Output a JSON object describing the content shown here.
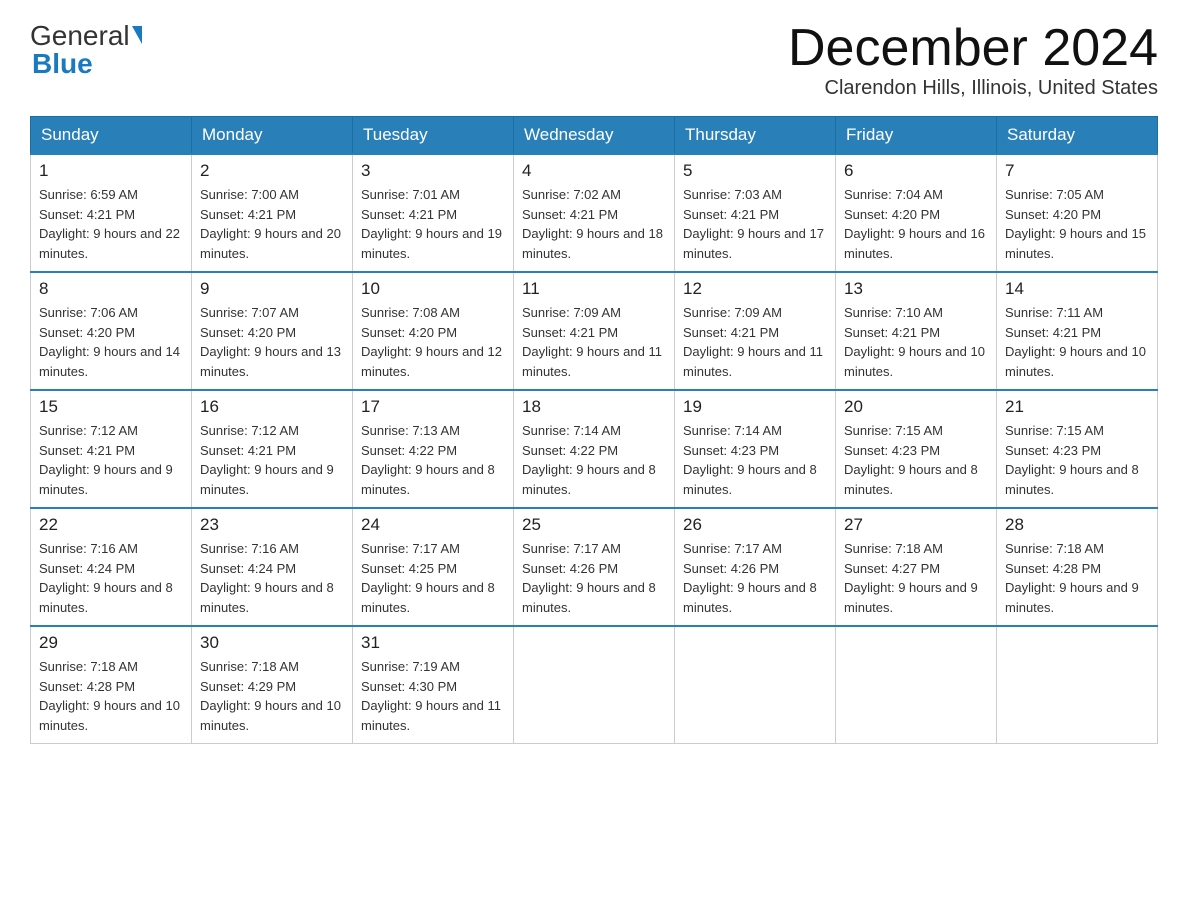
{
  "logo": {
    "general": "General",
    "blue": "Blue"
  },
  "header": {
    "month": "December 2024",
    "location": "Clarendon Hills, Illinois, United States"
  },
  "days_of_week": [
    "Sunday",
    "Monday",
    "Tuesday",
    "Wednesday",
    "Thursday",
    "Friday",
    "Saturday"
  ],
  "weeks": [
    [
      {
        "day": "1",
        "sunrise": "6:59 AM",
        "sunset": "4:21 PM",
        "daylight": "9 hours and 22 minutes."
      },
      {
        "day": "2",
        "sunrise": "7:00 AM",
        "sunset": "4:21 PM",
        "daylight": "9 hours and 20 minutes."
      },
      {
        "day": "3",
        "sunrise": "7:01 AM",
        "sunset": "4:21 PM",
        "daylight": "9 hours and 19 minutes."
      },
      {
        "day": "4",
        "sunrise": "7:02 AM",
        "sunset": "4:21 PM",
        "daylight": "9 hours and 18 minutes."
      },
      {
        "day": "5",
        "sunrise": "7:03 AM",
        "sunset": "4:21 PM",
        "daylight": "9 hours and 17 minutes."
      },
      {
        "day": "6",
        "sunrise": "7:04 AM",
        "sunset": "4:20 PM",
        "daylight": "9 hours and 16 minutes."
      },
      {
        "day": "7",
        "sunrise": "7:05 AM",
        "sunset": "4:20 PM",
        "daylight": "9 hours and 15 minutes."
      }
    ],
    [
      {
        "day": "8",
        "sunrise": "7:06 AM",
        "sunset": "4:20 PM",
        "daylight": "9 hours and 14 minutes."
      },
      {
        "day": "9",
        "sunrise": "7:07 AM",
        "sunset": "4:20 PM",
        "daylight": "9 hours and 13 minutes."
      },
      {
        "day": "10",
        "sunrise": "7:08 AM",
        "sunset": "4:20 PM",
        "daylight": "9 hours and 12 minutes."
      },
      {
        "day": "11",
        "sunrise": "7:09 AM",
        "sunset": "4:21 PM",
        "daylight": "9 hours and 11 minutes."
      },
      {
        "day": "12",
        "sunrise": "7:09 AM",
        "sunset": "4:21 PM",
        "daylight": "9 hours and 11 minutes."
      },
      {
        "day": "13",
        "sunrise": "7:10 AM",
        "sunset": "4:21 PM",
        "daylight": "9 hours and 10 minutes."
      },
      {
        "day": "14",
        "sunrise": "7:11 AM",
        "sunset": "4:21 PM",
        "daylight": "9 hours and 10 minutes."
      }
    ],
    [
      {
        "day": "15",
        "sunrise": "7:12 AM",
        "sunset": "4:21 PM",
        "daylight": "9 hours and 9 minutes."
      },
      {
        "day": "16",
        "sunrise": "7:12 AM",
        "sunset": "4:21 PM",
        "daylight": "9 hours and 9 minutes."
      },
      {
        "day": "17",
        "sunrise": "7:13 AM",
        "sunset": "4:22 PM",
        "daylight": "9 hours and 8 minutes."
      },
      {
        "day": "18",
        "sunrise": "7:14 AM",
        "sunset": "4:22 PM",
        "daylight": "9 hours and 8 minutes."
      },
      {
        "day": "19",
        "sunrise": "7:14 AM",
        "sunset": "4:23 PM",
        "daylight": "9 hours and 8 minutes."
      },
      {
        "day": "20",
        "sunrise": "7:15 AM",
        "sunset": "4:23 PM",
        "daylight": "9 hours and 8 minutes."
      },
      {
        "day": "21",
        "sunrise": "7:15 AM",
        "sunset": "4:23 PM",
        "daylight": "9 hours and 8 minutes."
      }
    ],
    [
      {
        "day": "22",
        "sunrise": "7:16 AM",
        "sunset": "4:24 PM",
        "daylight": "9 hours and 8 minutes."
      },
      {
        "day": "23",
        "sunrise": "7:16 AM",
        "sunset": "4:24 PM",
        "daylight": "9 hours and 8 minutes."
      },
      {
        "day": "24",
        "sunrise": "7:17 AM",
        "sunset": "4:25 PM",
        "daylight": "9 hours and 8 minutes."
      },
      {
        "day": "25",
        "sunrise": "7:17 AM",
        "sunset": "4:26 PM",
        "daylight": "9 hours and 8 minutes."
      },
      {
        "day": "26",
        "sunrise": "7:17 AM",
        "sunset": "4:26 PM",
        "daylight": "9 hours and 8 minutes."
      },
      {
        "day": "27",
        "sunrise": "7:18 AM",
        "sunset": "4:27 PM",
        "daylight": "9 hours and 9 minutes."
      },
      {
        "day": "28",
        "sunrise": "7:18 AM",
        "sunset": "4:28 PM",
        "daylight": "9 hours and 9 minutes."
      }
    ],
    [
      {
        "day": "29",
        "sunrise": "7:18 AM",
        "sunset": "4:28 PM",
        "daylight": "9 hours and 10 minutes."
      },
      {
        "day": "30",
        "sunrise": "7:18 AM",
        "sunset": "4:29 PM",
        "daylight": "9 hours and 10 minutes."
      },
      {
        "day": "31",
        "sunrise": "7:19 AM",
        "sunset": "4:30 PM",
        "daylight": "9 hours and 11 minutes."
      },
      null,
      null,
      null,
      null
    ]
  ],
  "labels": {
    "sunrise": "Sunrise:",
    "sunset": "Sunset:",
    "daylight": "Daylight:"
  }
}
